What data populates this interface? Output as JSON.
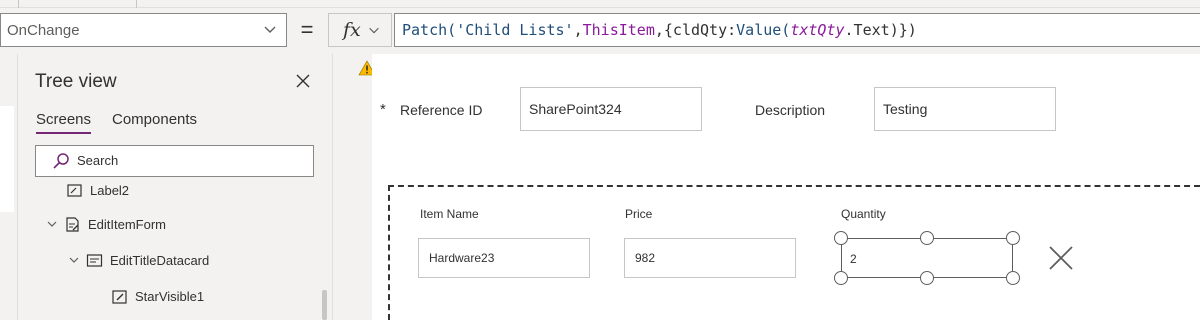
{
  "formula_bar": {
    "property": "OnChange",
    "equals": "=",
    "fx_label": "fx",
    "formula_tokens": [
      {
        "t": "Patch(",
        "k": "tok-fn"
      },
      {
        "t": "'Child Lists'",
        "k": "tok-str"
      },
      {
        "t": ",",
        "k": "tok-plain"
      },
      {
        "t": "ThisItem",
        "k": "tok-kw"
      },
      {
        "t": ",{cldQty:",
        "k": "tok-plain"
      },
      {
        "t": "Value(",
        "k": "tok-fn"
      },
      {
        "t": "txtQty",
        "k": "tok-var"
      },
      {
        "t": ".Text",
        "k": "tok-plain"
      },
      {
        "t": ")})",
        "k": "tok-plain"
      }
    ]
  },
  "tree_view": {
    "title": "Tree view",
    "tabs": {
      "screens": "Screens",
      "components": "Components"
    },
    "search_placeholder": "Search",
    "nodes": {
      "label2": "Label2",
      "edit_item_form": "EditItemForm",
      "edit_title_datacard": "EditTitleDatacard",
      "star_visible": "StarVisible1"
    }
  },
  "canvas": {
    "required_marker": "*",
    "reference_id_label": "Reference ID",
    "reference_id_value": "SharePoint324",
    "description_label": "Description",
    "description_value": "Testing",
    "gallery": {
      "item_name_label": "Item Name",
      "item_name_value": "Hardware23",
      "price_label": "Price",
      "price_value": "982",
      "quantity_label": "Quantity",
      "quantity_value": "2"
    }
  },
  "icons": [
    "chevron-down-icon",
    "close-icon",
    "search-icon",
    "warning-icon",
    "form-icon",
    "datacard-icon",
    "label-icon",
    "edit-icon",
    "delete-icon"
  ],
  "colors": {
    "accent": "#742774",
    "warning": "#ffb900",
    "keyword": "#8a1a9b",
    "function": "#1f4e79"
  }
}
